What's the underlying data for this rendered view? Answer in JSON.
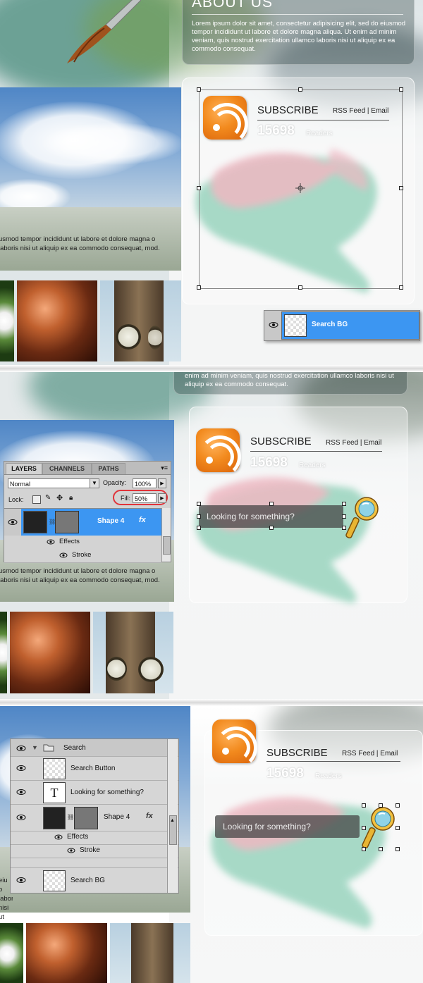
{
  "about": {
    "title": "ABOUT US",
    "text": "Lorem ipsum dolor sit amet, consectetur adipisicing elit, sed do eiusmod tempor incididunt ut labore et dolore magna aliqua. Ut enim ad minim veniam, quis nostrud exercitation ullamco laboris nisi ut aliquip ex ea commodo consequat.",
    "text_partial": "enim ad minim veniam, quis nostrud exercitation ullamco laboris nisi ut aliquip ex ea commodo consequat."
  },
  "caption": {
    "text": "usmod tempor incididunt ut labore et dolore magna o laboris nisi ut aliquip ex ea commodo consequat, mod.",
    "text_short": "eiu o laboris nisi ut aliquip ex ea commodo consequat, smod."
  },
  "subscribe": {
    "title": "SUBSCRIBE",
    "links": "RSS Feed | Email",
    "count": "15698",
    "readers": "Readers"
  },
  "search": {
    "placeholder": "Looking for something?"
  },
  "panel1": {
    "layer_row": "Search BG"
  },
  "layers_panel": {
    "tabs": [
      "LAYERS",
      "CHANNELS",
      "PATHS"
    ],
    "blend_mode": "Normal",
    "opacity_label": "Opacity:",
    "opacity_value": "100%",
    "lock_label": "Lock:",
    "fill_label": "Fill:",
    "fill_value": "50%",
    "layer_name": "Shape 4",
    "effects": "Effects",
    "stroke": "Stroke",
    "fx": "fx"
  },
  "layers_panel_3": {
    "group": "Search",
    "rows": [
      {
        "name": "Search Button"
      },
      {
        "name": "Looking for something?"
      },
      {
        "name": "Shape 4"
      },
      {
        "name": "Effects"
      },
      {
        "name": "Stroke"
      },
      {
        "name": "Search BG"
      }
    ],
    "type_glyph": "T",
    "fx": "fx"
  },
  "colors": {
    "rss_orange": "#f28a1e",
    "layer_highlight": "#3c96f2",
    "fill_highlight_ring": "#e0333a",
    "teal_wash": "#5fb89a",
    "pink_wash": "#e59aa8"
  }
}
